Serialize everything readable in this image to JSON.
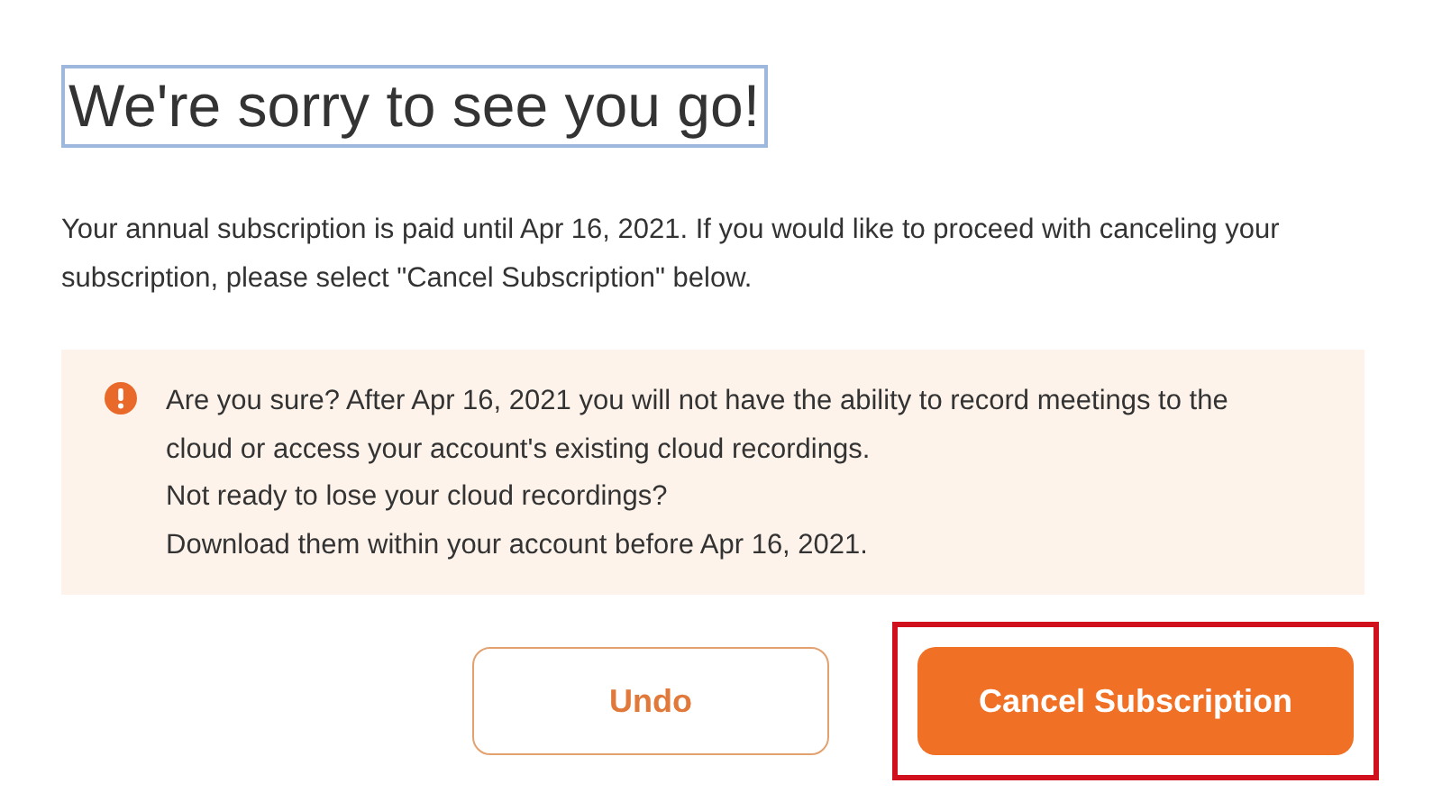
{
  "title": "We're sorry to see you go!",
  "message": "Your annual subscription is paid until Apr 16, 2021. If you would like to proceed with canceling your subscription, please select \"Cancel Subscription\" below.",
  "warning": {
    "lines": [
      "Are you sure? After Apr 16, 2021 you will not have the ability to record meetings to the cloud or access your account's existing cloud recordings.",
      "Not ready to lose your cloud recordings?",
      "Download them within your account before Apr 16, 2021."
    ]
  },
  "buttons": [
    {
      "label": "Undo",
      "kind": "secondary",
      "highlighted": false
    },
    {
      "label": "Cancel Subscription",
      "kind": "primary",
      "highlighted": true
    }
  ]
}
